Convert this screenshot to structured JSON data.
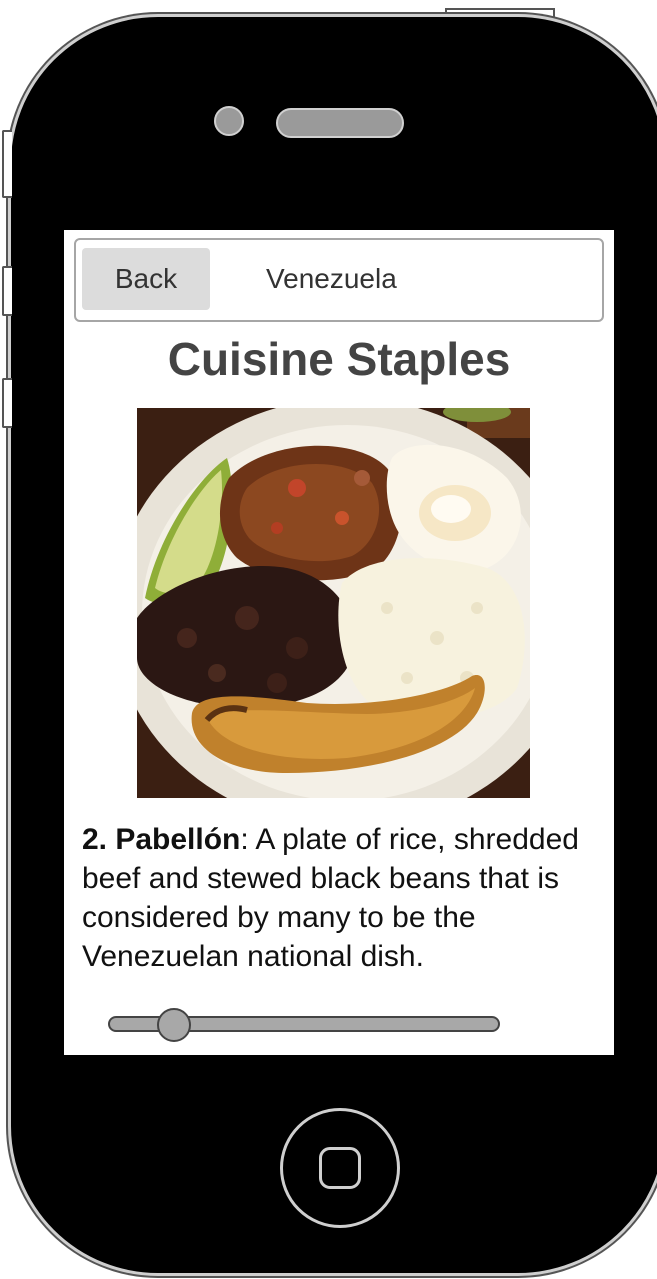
{
  "nav": {
    "back_label": "Back",
    "title": "Venezuela"
  },
  "page": {
    "title": "Cuisine Staples"
  },
  "item": {
    "number_name": "2. Pabellón",
    "description": ": A plate of rice, shredded beef and stewed black beans that is considered by many to be the Venezuelan national dish."
  },
  "slider": {
    "value_fraction": 0.17
  }
}
